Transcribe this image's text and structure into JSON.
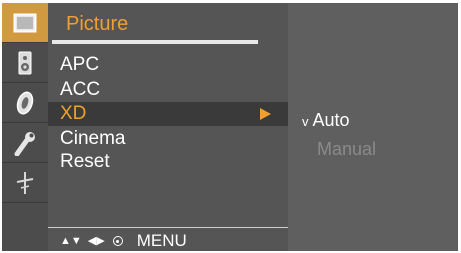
{
  "menu": {
    "title": "Picture",
    "items": [
      {
        "label": "APC",
        "selected": false
      },
      {
        "label": "ACC",
        "selected": false
      },
      {
        "label": "XD",
        "selected": true
      },
      {
        "label": "Cinema",
        "selected": false
      },
      {
        "label": "Reset",
        "selected": false
      }
    ]
  },
  "submenu": {
    "options": [
      {
        "check": "v",
        "label": "Auto",
        "enabled": true
      },
      {
        "check": "",
        "label": "Manual",
        "enabled": false
      }
    ]
  },
  "nav": {
    "updown": "▲▼",
    "leftright": "◀▶",
    "menu_label": "MENU"
  },
  "icons": [
    "picture-icon",
    "speaker-icon",
    "disc-icon",
    "wrench-icon",
    "antenna-icon"
  ],
  "colors": {
    "accent": "#f0a030",
    "active_tab": "#d29a40",
    "panel": "#555555"
  }
}
